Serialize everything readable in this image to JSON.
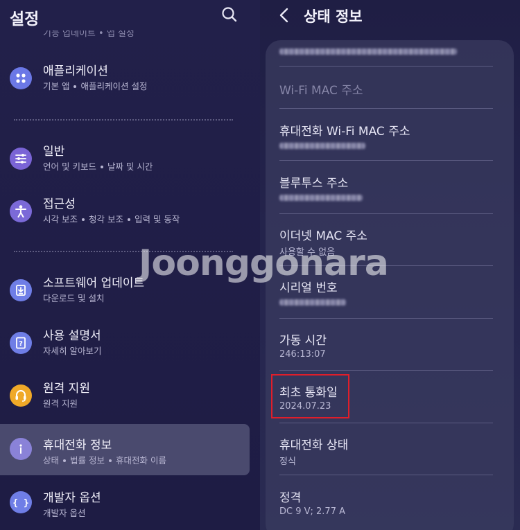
{
  "left": {
    "title": "설정",
    "cut_text": "기능 업데이트 • 앱 설정",
    "items": [
      {
        "title": "애플리케이션",
        "subs": [
          "기본 앱",
          "애플리케이션 설정"
        ],
        "icon": "grid-icon",
        "color": "#6b78e6"
      },
      {
        "title": "일반",
        "subs": [
          "언어 및 키보드",
          "날짜 및 시간"
        ],
        "icon": "sliders-icon",
        "color": "#7a64d6"
      },
      {
        "title": "접근성",
        "subs": [
          "시각 보조",
          "청각 보조",
          "입력 및 동작"
        ],
        "icon": "accessibility-icon",
        "color": "#7b6ad8"
      },
      {
        "title": "소프트웨어 업데이트",
        "subs": [
          "다운로드 및 설치"
        ],
        "icon": "download-icon",
        "color": "#6f7ee6"
      },
      {
        "title": "사용 설명서",
        "subs": [
          "자세히 알아보기"
        ],
        "icon": "manual-icon",
        "color": "#6f7ee6"
      },
      {
        "title": "원격 지원",
        "subs": [
          "원격 지원"
        ],
        "icon": "headset-icon",
        "color": "#f0a928"
      },
      {
        "title": "휴대전화 정보",
        "subs": [
          "상태",
          "법률 정보",
          "휴대전화 이름"
        ],
        "icon": "info-icon",
        "color": "#8a82d8"
      },
      {
        "title": "개발자 옵션",
        "subs": [
          "개발자 옵션"
        ],
        "icon": "code-braces-icon",
        "color": "#6f7ee6"
      }
    ]
  },
  "right": {
    "title": "상태 정보",
    "rows": [
      {
        "label": "Wi-Fi MAC 주소",
        "value": ""
      },
      {
        "label": "휴대전화 Wi-Fi MAC 주소",
        "value": ""
      },
      {
        "label": "블루투스 주소",
        "value": ""
      },
      {
        "label": "이더넷 MAC 주소",
        "value": "사용할 수 없음"
      },
      {
        "label": "시리얼 번호",
        "value": ""
      },
      {
        "label": "가동 시간",
        "value": "246:13:07"
      },
      {
        "label": "최초 통화일",
        "value": "2024.07.23"
      },
      {
        "label": "휴대전화 상태",
        "value": "정식"
      },
      {
        "label": "정격",
        "value": "DC 9 V; 2.77 A"
      }
    ]
  },
  "watermark": "Joonggonara"
}
